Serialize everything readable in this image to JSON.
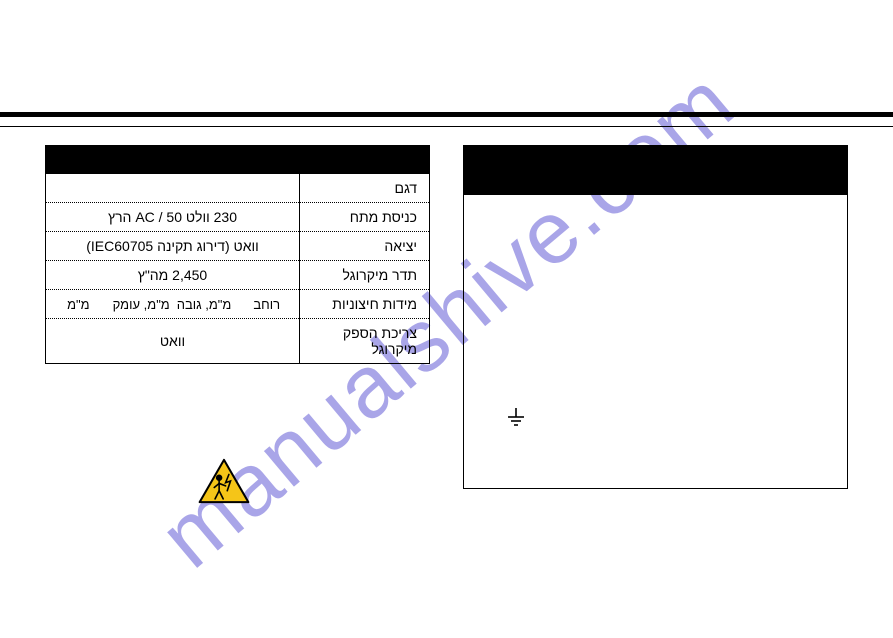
{
  "watermark": "manualshive.com",
  "specs": {
    "header": "",
    "rows": {
      "model": {
        "label": "דגם",
        "value": ""
      },
      "input": {
        "label": "כניסת מתח",
        "value": "230 וולט AC / 50 הרץ"
      },
      "output": {
        "label": "יציאה",
        "value": "וואט (דירוג תקינה IEC60705)"
      },
      "frequency": {
        "label": "תדר מיקרוגל",
        "value": "2,450 מה\"ץ"
      },
      "dimensions": {
        "label": "מידות חיצוניות",
        "width_label": "רוחב",
        "width_val": "מ\"מ, גובה",
        "height_val": "מ\"מ, עומק",
        "depth_val": "מ\"מ"
      },
      "consumption": {
        "label": "צריכת הספק מיקרוגל",
        "value": "וואט"
      }
    }
  },
  "right_panel": {
    "header": ""
  },
  "icons": {
    "hazard": "electric-shock-warning-icon",
    "earth": "earth-ground-symbol-icon"
  }
}
